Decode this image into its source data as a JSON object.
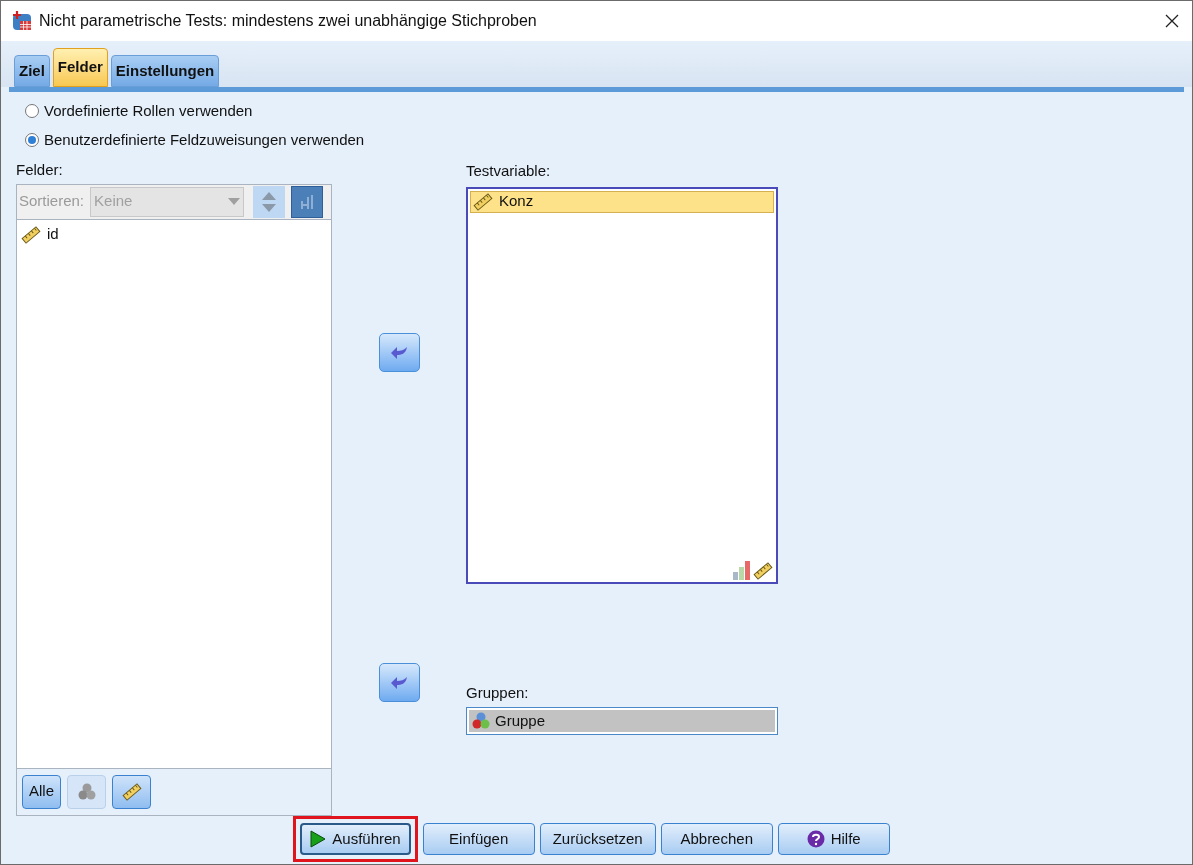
{
  "window": {
    "title": "Nicht parametrische Tests: mindestens zwei unabhängige Stichproben"
  },
  "tabs": [
    {
      "label": "Ziel",
      "selected": false
    },
    {
      "label": "Felder",
      "selected": true
    },
    {
      "label": "Einstellungen",
      "selected": false
    }
  ],
  "radio_options": [
    {
      "label": "Vordefinierte Rollen verwenden",
      "selected": false
    },
    {
      "label": "Benutzerdefinierte Feldzuweisungen verwenden",
      "selected": true
    }
  ],
  "fields_panel": {
    "label": "Felder:",
    "sort_label": "Sortieren:",
    "sort_value": "Keine",
    "items": [
      {
        "name": "id",
        "kind": "scale"
      }
    ],
    "filter_buttons": [
      {
        "kind": "text",
        "label": "Alle",
        "disabled": false
      },
      {
        "kind": "nominal",
        "disabled": true
      },
      {
        "kind": "scale",
        "disabled": false
      }
    ]
  },
  "test_variable": {
    "label": "Testvariable:",
    "items": [
      {
        "name": "Konz",
        "kind": "scale",
        "selected": true
      }
    ]
  },
  "groups": {
    "label": "Gruppen:",
    "items": [
      {
        "name": "Gruppe",
        "kind": "nominal"
      }
    ]
  },
  "buttons": [
    {
      "label": "Ausführen",
      "kind": "run",
      "highlighted": true
    },
    {
      "label": "Einfügen",
      "kind": "plain",
      "highlighted": false
    },
    {
      "label": "Zurücksetzen",
      "kind": "plain",
      "highlighted": false
    },
    {
      "label": "Abbrechen",
      "kind": "plain",
      "highlighted": false
    },
    {
      "label": "Hilfe",
      "kind": "help",
      "highlighted": false
    }
  ]
}
